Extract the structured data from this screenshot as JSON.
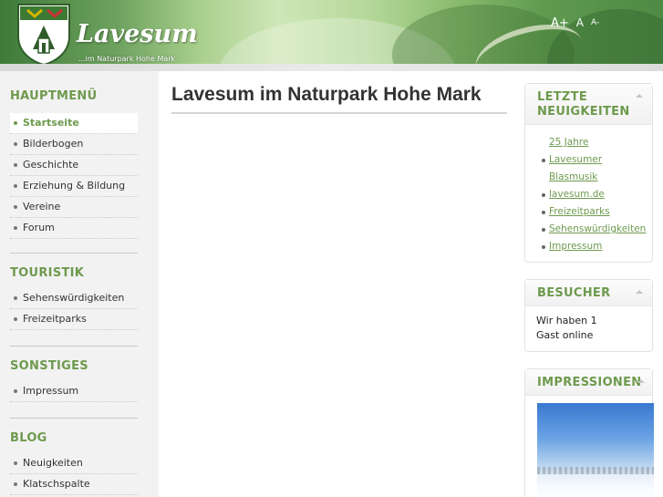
{
  "site": {
    "title": "Lavesum",
    "subtitle": "...im Naturpark Hohe Mark",
    "font_sizer": {
      "large": "A+",
      "normal": "A",
      "small": "A-"
    }
  },
  "colors": {
    "accent": "#6e9a4e",
    "sidebar_bg": "#f2f2f2"
  },
  "sidebar": {
    "sections": [
      {
        "title": "HAUPTMENÜ",
        "items": [
          "Startseite",
          "Bilderbogen",
          "Geschichte",
          "Erziehung & Bildung",
          "Vereine",
          "Forum"
        ],
        "active": 0
      },
      {
        "title": "TOURISTIK",
        "items": [
          "Sehenswürdigkeiten",
          "Freizeitparks"
        ]
      },
      {
        "title": "SONSTIGES",
        "items": [
          "Impressum"
        ]
      },
      {
        "title": "BLOG",
        "items": [
          "Neuigkeiten",
          "Klatschspalte"
        ]
      }
    ]
  },
  "main": {
    "page_title": "Lavesum im Naturpark Hohe Mark"
  },
  "modules": {
    "news": {
      "title_line1": "LETZTE",
      "title_line2": "NEUIGKEITEN",
      "items": [
        "25 Jahre",
        "Lavesumer",
        "Blasmusik",
        "lavesum.de",
        "Freizeitparks",
        "Sehenswürdigkeiten",
        "Impressum"
      ]
    },
    "visitors": {
      "title": "BESUCHER",
      "line1": "Wir haben 1",
      "line2": "Gast online"
    },
    "impressions": {
      "title": "IMPRESSIONEN"
    }
  }
}
